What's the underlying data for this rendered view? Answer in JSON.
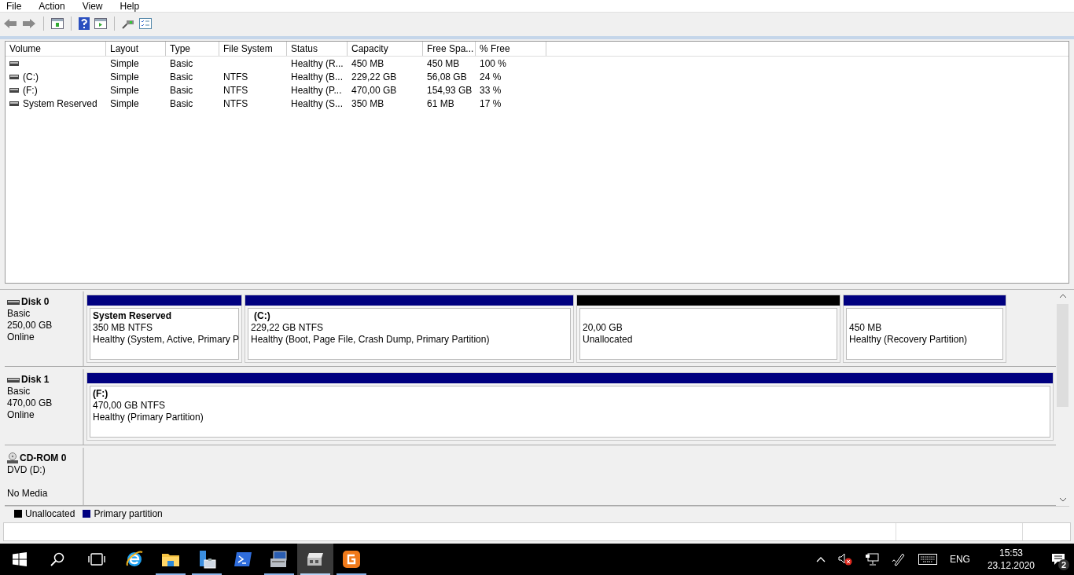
{
  "menu": [
    "File",
    "Action",
    "View",
    "Help"
  ],
  "volume_list": {
    "columns": [
      "Volume",
      "Layout",
      "Type",
      "File System",
      "Status",
      "Capacity",
      "Free Spa...",
      "% Free"
    ],
    "rows": [
      {
        "cells": [
          "",
          "Simple",
          "Basic",
          "",
          "Healthy (R...",
          "450 MB",
          "450 MB",
          "100 %"
        ]
      },
      {
        "cells": [
          "(C:)",
          "Simple",
          "Basic",
          "NTFS",
          "Healthy (B...",
          "229,22 GB",
          "56,08 GB",
          "24 %"
        ]
      },
      {
        "cells": [
          "(F:)",
          "Simple",
          "Basic",
          "NTFS",
          "Healthy (P...",
          "470,00 GB",
          "154,93 GB",
          "33 %"
        ]
      },
      {
        "cells": [
          "System Reserved",
          "Simple",
          "Basic",
          "NTFS",
          "Healthy (S...",
          "350 MB",
          "61 MB",
          "17 %"
        ]
      }
    ]
  },
  "disks": [
    {
      "kind": "disk",
      "name": "Disk 0",
      "lines": [
        "Basic",
        "250,00 GB",
        "Online"
      ],
      "partitions": [
        {
          "kind": "primary",
          "title": "System Reserved",
          "size": "350 MB NTFS",
          "status": "Healthy (System, Active, Primary P"
        },
        {
          "kind": "primary",
          "title": "(C:)",
          "size": "229,22 GB NTFS",
          "status": "Healthy (Boot, Page File, Crash Dump, Primary Partition)"
        },
        {
          "kind": "unallocated",
          "size": "20,00 GB",
          "status": "Unallocated"
        },
        {
          "kind": "primary",
          "size": "450 MB",
          "status": "Healthy (Recovery Partition)"
        }
      ]
    },
    {
      "kind": "disk",
      "name": "Disk 1",
      "lines": [
        "Basic",
        "470,00 GB",
        "Online"
      ],
      "partitions": [
        {
          "kind": "primary",
          "title": "(F:)",
          "size": "470,00 GB NTFS",
          "status": "Healthy (Primary Partition)"
        }
      ]
    },
    {
      "kind": "cdrom",
      "name": "CD-ROM 0",
      "lines": [
        "DVD (D:)",
        "No Media"
      ]
    }
  ],
  "legend": [
    {
      "label": "Unallocated",
      "color": "#000000"
    },
    {
      "label": "Primary partition",
      "color": "#000080"
    }
  ],
  "taskbar": {
    "apps": [
      {
        "kind": "ie",
        "running": false,
        "active": false
      },
      {
        "kind": "explorer",
        "running": true,
        "active": false
      },
      {
        "kind": "server",
        "running": true,
        "active": false
      },
      {
        "kind": "powershell",
        "running": false,
        "active": false
      },
      {
        "kind": "computer",
        "running": true,
        "active": false
      },
      {
        "kind": "disk",
        "running": true,
        "active": true
      },
      {
        "kind": "gapp",
        "running": true,
        "active": false
      }
    ],
    "language": "ENG",
    "time": "15:53",
    "date": "23.12.2020",
    "notifications": "2"
  }
}
